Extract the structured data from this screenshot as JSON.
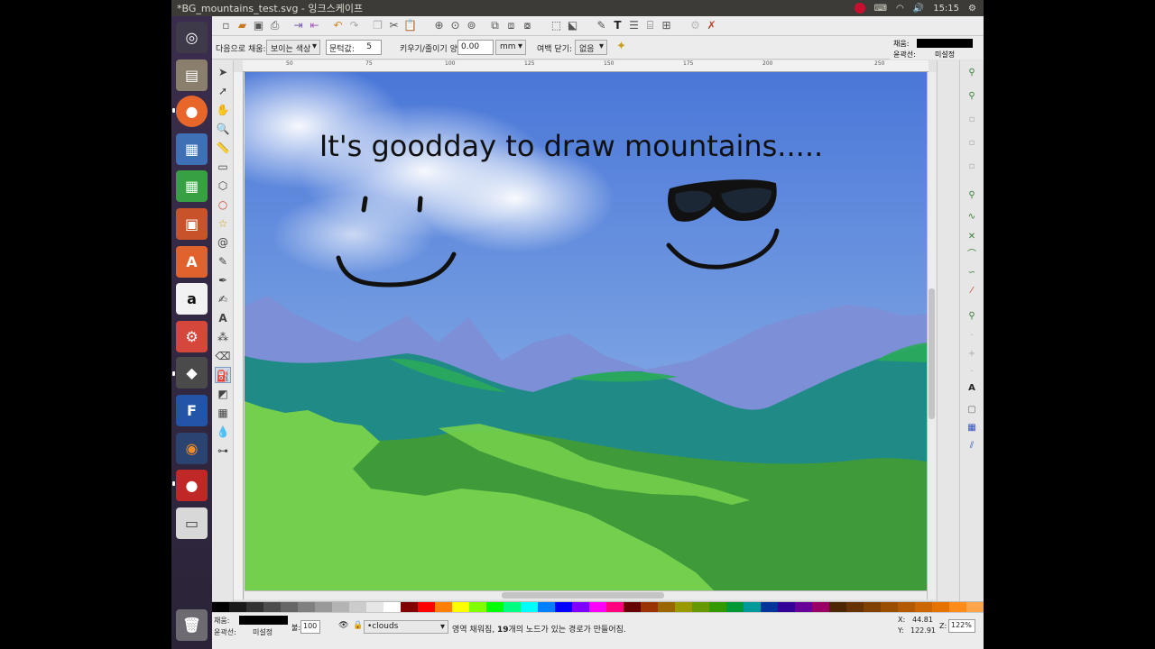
{
  "window": {
    "title": "*BG_mountains_test.svg - 잉크스케이프",
    "clock": "15:15"
  },
  "toolctrl": {
    "fill_label": "다음으로 채움:",
    "fill_value": "보이는 색상",
    "threshold_label": "문턱값:",
    "threshold_value": "5",
    "grow_label": "키우기/줄이기 양:",
    "grow_value": "0.00",
    "unit": "mm",
    "close_gaps_label": "여백 닫기:",
    "close_gaps_value": "없음",
    "fill_indicator_label": "채움:",
    "stroke_indicator_label": "윤곽선:",
    "stroke_indicator_value": "미설정"
  },
  "ruler": {
    "ticks": [
      "50",
      "75",
      "100",
      "125",
      "150",
      "175",
      "200",
      "250"
    ]
  },
  "canvas": {
    "headline": "It's goodday to draw mountains....."
  },
  "status": {
    "fill_label": "채움:",
    "stroke_label": "윤곽선:",
    "stroke_value": "미설정",
    "opacity_label": "불:",
    "opacity_value": "100",
    "layer": "•clouds",
    "message_pre": "영역 채워짐, ",
    "message_count": "19",
    "message_post": "개의 노드가 있는 경로가 만들어짐.",
    "x_label": "X:",
    "x_value": "44.81",
    "y_label": "Y:",
    "y_value": "122.91",
    "zoom_label": "Z:",
    "zoom_value": "122%"
  },
  "colors": {
    "sky_top": "#4a77d8",
    "sky_bottom": "#9ec1ea",
    "mountain_far": "#7d8fd6",
    "hills_teal": "#1f8a86",
    "hills_green": "#2aaa5a",
    "grass_light": "#74cf4d",
    "grass_dark": "#3f9a3a"
  }
}
